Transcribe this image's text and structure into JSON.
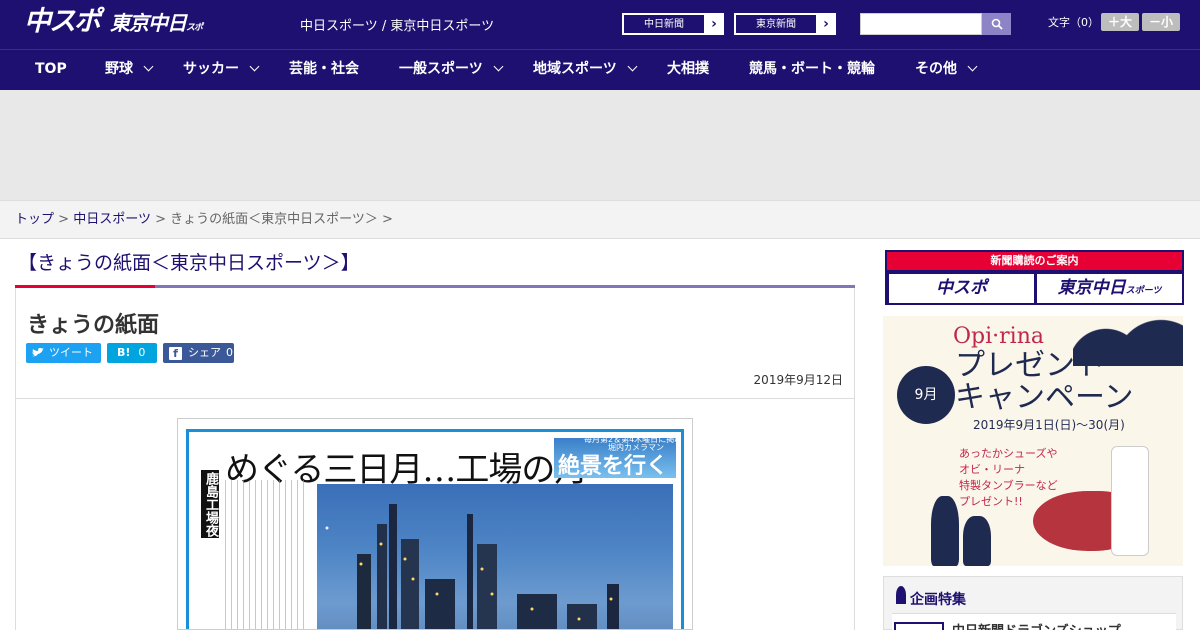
{
  "header": {
    "logo_chuspo": "中スポ",
    "logo_tokyo": "東京中日",
    "logo_tokyo_small": "スポーツ",
    "site_title": "中日スポーツ / 東京中日スポーツ",
    "paper_buttons": [
      {
        "label": "中日新聞",
        "arrow": "›"
      },
      {
        "label": "東京新聞",
        "arrow": "›"
      }
    ],
    "search": {
      "placeholder": ""
    },
    "font_size": {
      "label": "文字（0）",
      "bigger": "＋大",
      "smaller": "－小"
    }
  },
  "nav": {
    "items": [
      {
        "label": "TOP",
        "dropdown": false
      },
      {
        "label": "野球",
        "dropdown": true
      },
      {
        "label": "サッカー",
        "dropdown": true
      },
      {
        "label": "芸能・社会",
        "dropdown": false
      },
      {
        "label": "一般スポーツ",
        "dropdown": true
      },
      {
        "label": "地域スポーツ",
        "dropdown": true
      },
      {
        "label": "大相撲",
        "dropdown": false
      },
      {
        "label": "競馬・ボート・競輪",
        "dropdown": false
      },
      {
        "label": "その他",
        "dropdown": true
      }
    ]
  },
  "breadcrumb": {
    "items": [
      "トップ",
      "中日スポーツ",
      "きょうの紙面＜東京中日スポーツ＞"
    ],
    "separator": ">"
  },
  "page": {
    "heading": "【きょうの紙面＜東京中日スポーツ＞】",
    "article_title": "きょうの紙面",
    "sns": {
      "tweet": "ツイート",
      "hatena_label": "B!",
      "hatena_count": "0",
      "share": "シェア",
      "share_count": "0"
    },
    "date": "2019年9月12日"
  },
  "newspaper": {
    "headline": "めぐる三日月…工場の月",
    "corner_top": "毎月第2＆第4木曜日に掲載",
    "corner_tag": "堀内カメラマン",
    "corner_title": "絶景を行く",
    "vertical_label": "鹿島工場夜景"
  },
  "sidebar": {
    "subscribe_title": "新聞購読のご案内",
    "subscribe_left": "中スポ",
    "subscribe_right": "東京中日",
    "subscribe_right_small": "スポーツ",
    "banner": {
      "brand": "Opi·rina",
      "headline": "プレゼント\nキャンペーン",
      "month": "9月",
      "dates": "2019年9月1日(日)～30(月)",
      "copy": "あったかシューズや\nオビ・リーナ\n特製タンブラーなど\nプレゼント!!"
    },
    "feature_title": "企画特集",
    "feature_item": "中日新聞ドラゴンズショップ"
  },
  "colors": {
    "brand_navy": "#1e1070",
    "accent_red": "#e60033",
    "twitter_blue": "#1da1f2",
    "hatena_blue": "#00a4de",
    "facebook_blue": "#3b5998"
  }
}
